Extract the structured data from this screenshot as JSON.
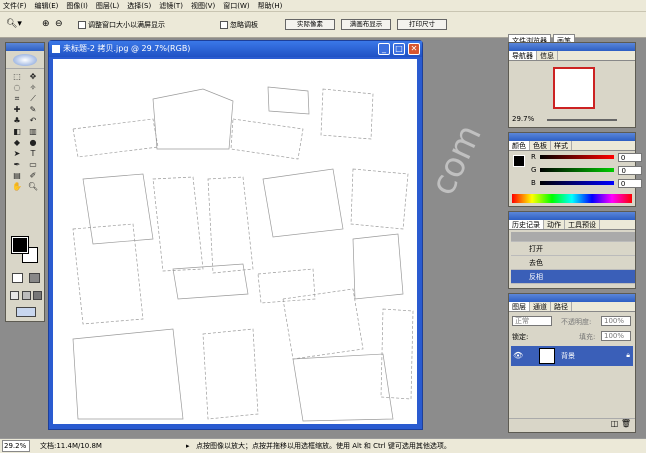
{
  "menu": [
    "文件(F)",
    "编辑(E)",
    "图像(I)",
    "图层(L)",
    "选择(S)",
    "滤镜(T)",
    "视图(V)",
    "窗口(W)",
    "帮助(H)"
  ],
  "options": {
    "resize_windows": "调整窗口大小以满屏显示",
    "ignore_palettes": "忽略调板",
    "actual_pixels": "实际像素",
    "fit_screen": "满画布显示",
    "print_size": "打印尺寸"
  },
  "palette_well": [
    "文件浏览器",
    "画笔"
  ],
  "document": {
    "title": "未标题-2 拷贝.jpg @ 29.7%(RGB)"
  },
  "navigator": {
    "tabs": [
      "导航器",
      "信息"
    ],
    "zoom": "29.7%"
  },
  "color": {
    "tabs": [
      "颜色",
      "色板",
      "样式"
    ],
    "r_label": "R",
    "g_label": "G",
    "b_label": "B",
    "r": "0",
    "g": "0",
    "b": "0"
  },
  "history": {
    "tabs": [
      "历史记录",
      "动作",
      "工具预设"
    ],
    "items": [
      "打开",
      "去色",
      "反相"
    ]
  },
  "layers": {
    "tabs": [
      "图层",
      "通道",
      "路径"
    ],
    "mode": "正常",
    "opacity_label": "不透明度:",
    "opacity": "100%",
    "lock_label": "锁定:",
    "fill_label": "填充:",
    "fill": "100%",
    "layer_name": "背景"
  },
  "status": {
    "zoom": "29.2%",
    "doc_size": "文档:11.4M/10.8M",
    "hint": "点按图像以放大；点按并拖移以用选框缩放。使用 Alt 和 Ctrl 键可选用其他选项。"
  }
}
